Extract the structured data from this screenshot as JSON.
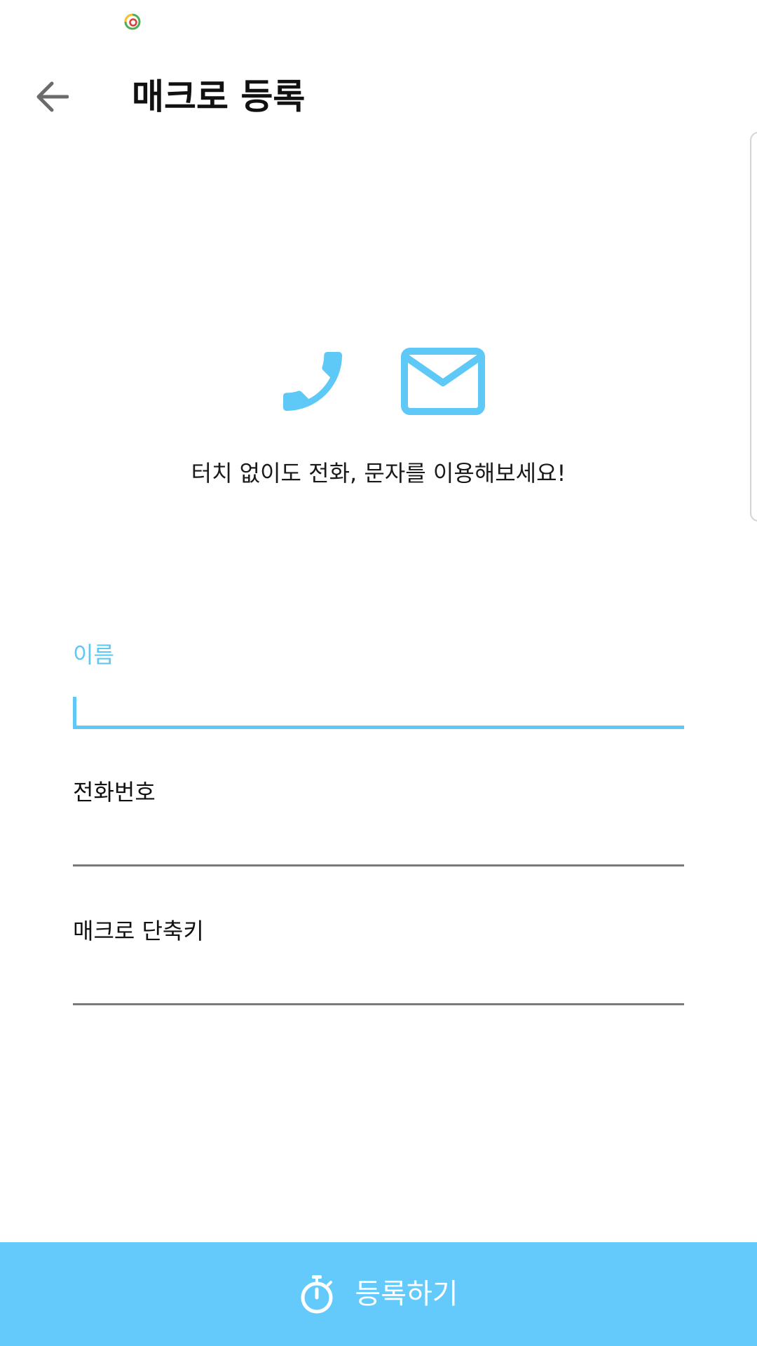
{
  "app": {
    "title": "매크로 등록",
    "accent_color": "#5ec8f7"
  },
  "header": {
    "back_icon": "arrow-left-icon"
  },
  "hero": {
    "icons": [
      "phone-icon",
      "mail-icon"
    ],
    "text": "터치 없이도 전화, 문자를 이용해보세요!"
  },
  "form": {
    "fields": [
      {
        "label": "이름",
        "value": "",
        "focused": true
      },
      {
        "label": "전화번호",
        "value": "",
        "focused": false
      },
      {
        "label": "매크로 단축키",
        "value": "",
        "focused": false
      }
    ]
  },
  "footer": {
    "button_label": "등록하기",
    "button_icon": "stopwatch-icon",
    "button_color": "#64cafc"
  }
}
